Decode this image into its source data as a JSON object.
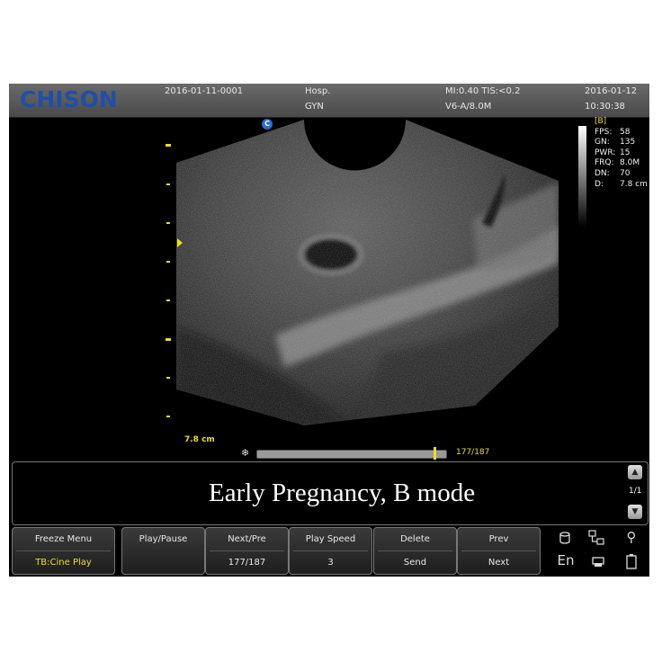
{
  "header": {
    "brand": "CHISON",
    "patient_id": "2016-01-11-0001",
    "hospital": "Hosp.",
    "exam": "GYN",
    "mi_tis": "MI:0.40  TIS:<0.2",
    "probe": "V6-A/8.0M",
    "date": "2016-01-12",
    "time": "10:30:38"
  },
  "image": {
    "probe_marker": "C",
    "depth_label": "7.8 cm"
  },
  "params": {
    "mode": "[B]",
    "items": [
      {
        "k": "FPS:",
        "v": "58"
      },
      {
        "k": "GN:",
        "v": "135"
      },
      {
        "k": "PWR:",
        "v": "15"
      },
      {
        "k": "FRQ:",
        "v": "8.0M"
      },
      {
        "k": "DN:",
        "v": "70"
      },
      {
        "k": "D:",
        "v": "7.8 cm"
      }
    ]
  },
  "cine": {
    "frame_counter": "177/187",
    "current": 177,
    "total": 187
  },
  "comment": {
    "caption": "Early Pregnancy, B mode",
    "page": "1/1"
  },
  "softkeys": [
    {
      "top": "Freeze Menu",
      "bottom": "TB:Cine Play"
    },
    {
      "top": "Play/Pause",
      "bottom": ""
    },
    {
      "top": "Next/Pre",
      "bottom": "177/187"
    },
    {
      "top": "Play Speed",
      "bottom": "3"
    },
    {
      "top": "Delete",
      "bottom": "Send"
    },
    {
      "top": "Prev",
      "bottom": "Next"
    }
  ],
  "system": {
    "language": "En"
  },
  "colors": {
    "yellow": "#e5e023",
    "brand_blue": "#1f4fa8"
  }
}
